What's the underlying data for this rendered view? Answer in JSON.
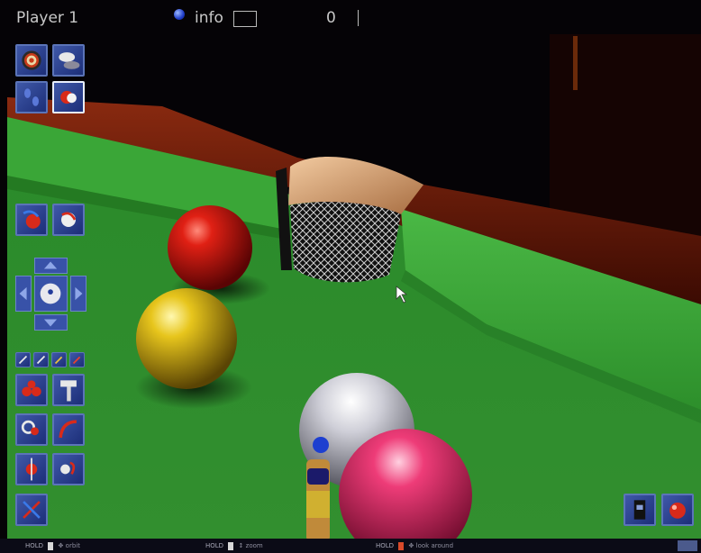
{
  "header": {
    "player_label": "Player 1",
    "info_label": "info",
    "score": "0"
  },
  "icons": {
    "dartboard": "dartboard-icon",
    "hat": "hat-icon",
    "footprints": "footprints-icon",
    "cue_ball": "cue-ball-icon",
    "view_left": "view-left-icon",
    "view_right": "view-right-icon",
    "spin_left": "spin-left-icon",
    "spin_right": "spin-right-icon",
    "trickshot": "trickshot-icon",
    "cue": "cue-icon",
    "zoom": "magnifier-icon",
    "curve": "curve-icon",
    "swerve": "swerve-icon",
    "jump": "jump-icon",
    "replay": "replay-icon",
    "camera": "camera-icon",
    "red_ball": "red-ball-icon"
  },
  "footer": {
    "hint1_hold": "HOLD",
    "hint1_action": "orbit",
    "hint2_hold": "HOLD",
    "hint2_action": "zoom",
    "hint3_hold": "HOLD",
    "hint3_action": "look around"
  },
  "colors": {
    "felt": "#2f8d2e",
    "cushion": "#3da63a",
    "rail_wood": "#6e1a08",
    "tool_frame": "#5b74b8",
    "red_ball": "#c81a10",
    "yellow_ball": "#d8b414",
    "white_ball": "#d8d8e2",
    "pink_ball": "#e0306a"
  }
}
